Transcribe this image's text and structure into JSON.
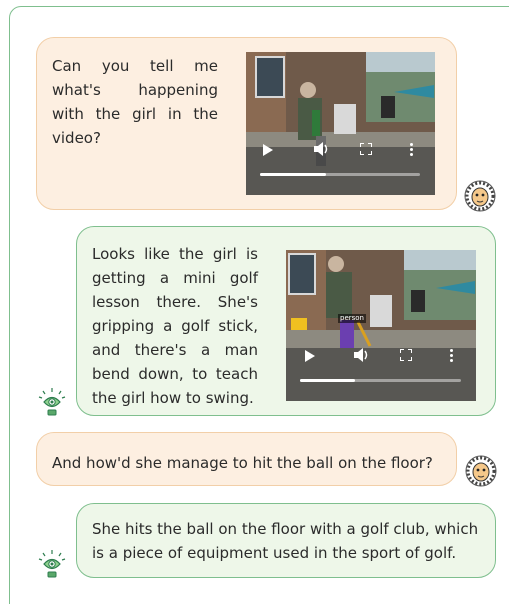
{
  "conversation": {
    "messages": [
      {
        "role": "user",
        "text": "Can you tell me what's happening with the girl in the video?"
      },
      {
        "role": "assistant",
        "text": "Looks like the girl is getting a mini golf lesson there. She's gripping a golf stick, and there's a man bend down, to teach the girl how to swing."
      },
      {
        "role": "user",
        "text": "And how'd she manage to hit the ball on the floor?"
      },
      {
        "role": "assistant",
        "text": "She hits the ball on the floor with a golf club, which is a piece of equipment used in the sport of golf."
      }
    ]
  },
  "video2": {
    "detection_label": "person"
  },
  "video1": {
    "progress": 0.41
  },
  "video2_progress": 0.34,
  "icons": {
    "user_avatar": "lion-face-icon",
    "assistant_avatar": "lightbulb-eye-icon"
  },
  "colors": {
    "user_bubble": "#fdefe1",
    "user_border": "#f2cfa8",
    "assistant_bubble": "#eef7e9",
    "assistant_border": "#7fbf8e"
  }
}
